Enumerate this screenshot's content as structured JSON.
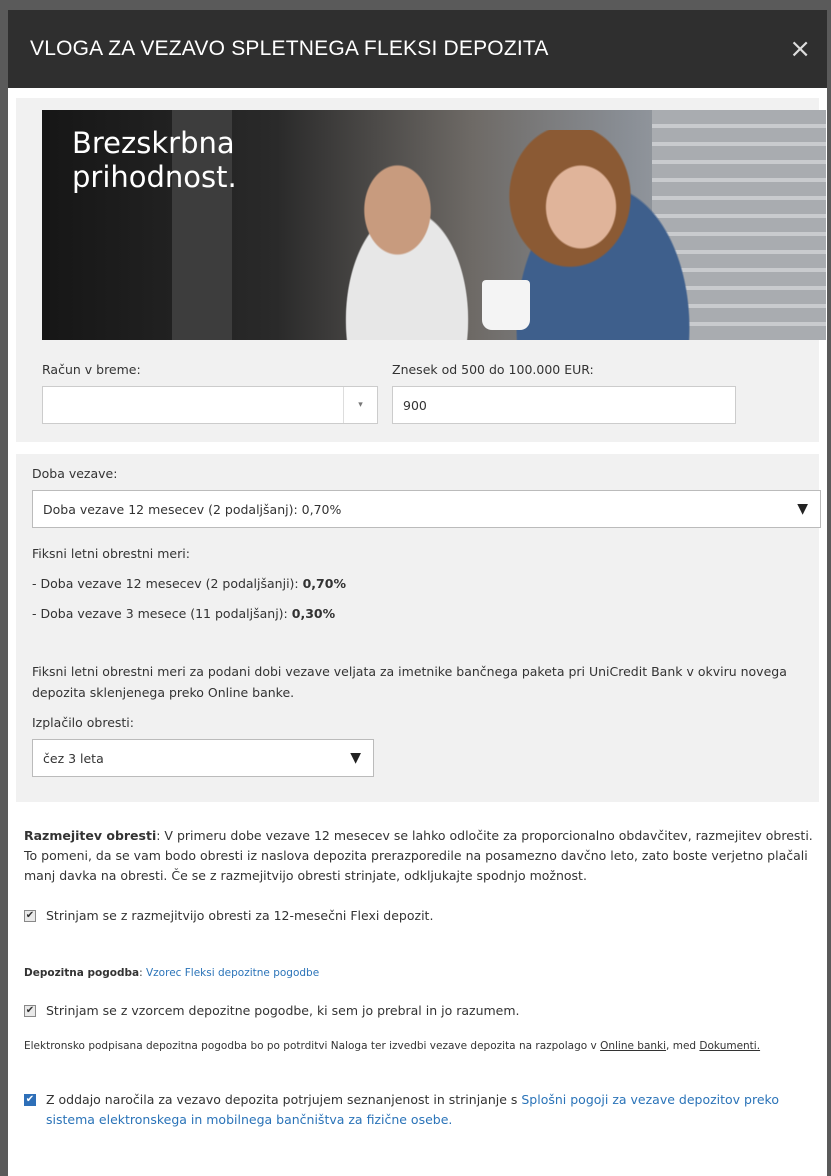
{
  "modal": {
    "title": "VLOGA ZA VEZAVO SPLETNEGA FLEKSI DEPOZITA",
    "close_icon": "×"
  },
  "hero": {
    "line1": "Brezskrbna",
    "line2": "prihodnost."
  },
  "account": {
    "label": "Račun v breme:",
    "value": ""
  },
  "amount": {
    "label": "Znesek od 500 do 100.000 EUR:",
    "value": "900"
  },
  "term": {
    "label": "Doba vezave:",
    "selected": "Doba vezave 12 mesecev (2 podaljšanj): 0,70%"
  },
  "rates": {
    "title": "Fiksni letni obrestni meri:",
    "items": [
      {
        "text": "- Doba vezave 12 mesecev (2 podaljšanji): ",
        "rate": "0,70%"
      },
      {
        "text": "- Doba vezave  3 mesece (11 podaljšanj): ",
        "rate": "0,30%"
      }
    ],
    "note": "Fiksni letni obrestni meri za podani dobi vezave veljata za imetnike bančnega paketa pri UniCredit Bank v okviru novega depozita sklenjenega preko Online banke."
  },
  "payout": {
    "label": "Izplačilo obresti:",
    "selected": "čez 3 leta"
  },
  "split": {
    "title": "Razmejitev obresti",
    "text": ": V primeru dobe vezave 12 mesecev se lahko odločite za proporcionalno obdavčitev, razmejitev obresti. To pomeni, da se vam bodo obresti iz naslova depozita prerazporedile na posamezno davčno leto, zato boste verjetno plačali manj davka na obresti. Če se z razmejitvijo obresti strinjate, odkljukajte spodnjo možnost.",
    "checkbox_label": "Strinjam se z razmejitvijo obresti za 12-mesečni Flexi depozit."
  },
  "contract": {
    "title": "Depozitna pogodba",
    "separator": ": ",
    "link": "Vzorec Fleksi depozitne pogodbe",
    "checkbox_label": "Strinjam se z vzorcem depozitne pogodbe, ki sem jo prebral in jo razumem.",
    "info_prefix": "Elektronsko podpisana depozitna pogodba bo po potrditvi Naloga ter izvedbi vezave depozita na razpolago v ",
    "info_link1": "Online banki",
    "info_mid": ", med ",
    "info_link2": "Dokumenti."
  },
  "consent": {
    "text": "Z oddajo naročila za vezavo depozita potrjujem seznanjenost in strinjanje s ",
    "link": "Splošni pogoji za vezave depozitov preko sistema elektronskega in mobilnega bančništva za fizične osebe."
  },
  "glyphs": {
    "check": "✔",
    "triangle": "▼",
    "small_arrow": "▾"
  },
  "colors": {
    "header_bg": "#2f2f2f",
    "panel_bg": "#f1f1f1",
    "link": "#2a73b8",
    "checkbox_checked": "#2e6fb8"
  }
}
